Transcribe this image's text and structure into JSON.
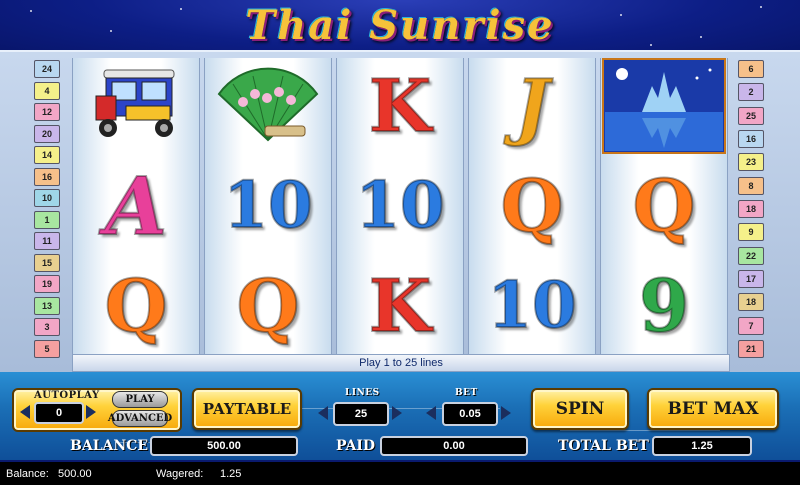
{
  "game": {
    "title": "Thai Sunrise"
  },
  "paylines": {
    "left": [
      "24",
      "4",
      "12",
      "20",
      "14",
      "16",
      "10",
      "1",
      "11",
      "15",
      "19",
      "13",
      "3",
      "5"
    ],
    "right": [
      "6",
      "2",
      "25",
      "16",
      "23",
      "8",
      "18",
      "9",
      "22",
      "17",
      "18",
      "7",
      "21"
    ],
    "left_colors": [
      "#b9d7f0",
      "#f5f08a",
      "#f2a6c6",
      "#c9b6ea",
      "#f5f08a",
      "#f6c08a",
      "#9fd6e8",
      "#a8e6a0",
      "#c9b6ea",
      "#e8d090",
      "#f2a6c6",
      "#a8e6a0",
      "#f2a6c6",
      "#f5a0a0"
    ],
    "right_colors": [
      "#f6c08a",
      "#c9b6ea",
      "#f2a6c6",
      "#b9d7f0",
      "#f5f08a",
      "#f6c08a",
      "#f2a6c6",
      "#f5f08a",
      "#a8e6a0",
      "#c9b6ea",
      "#e8d090",
      "#f2a6c6",
      "#f5a0a0"
    ]
  },
  "reels": [
    [
      {
        "icon": "tuk-tuk-icon"
      },
      {
        "symbol": "A",
        "cls": "sym-A"
      },
      {
        "symbol": "Q",
        "cls": "sym-Q"
      }
    ],
    [
      {
        "icon": "fan-icon"
      },
      {
        "symbol": "10",
        "cls": "sym-10"
      },
      {
        "symbol": "Q",
        "cls": "sym-Q"
      }
    ],
    [
      {
        "symbol": "K",
        "cls": "sym-K"
      },
      {
        "symbol": "10",
        "cls": "sym-10"
      },
      {
        "symbol": "K",
        "cls": "sym-K"
      }
    ],
    [
      {
        "symbol": "J",
        "cls": "sym-J"
      },
      {
        "symbol": "Q",
        "cls": "sym-Q"
      },
      {
        "symbol": "10",
        "cls": "sym-10"
      }
    ],
    [
      {
        "icon": "temple-scene-icon"
      },
      {
        "symbol": "Q",
        "cls": "sym-Q"
      },
      {
        "symbol": "9",
        "cls": "sym-9"
      }
    ]
  ],
  "message": "Play 1 to 25 lines",
  "controls": {
    "autoplay_label": "AUTOPLAY",
    "autoplay_value": "0",
    "play_label": "PLAY",
    "advanced_label": "ADVANCED",
    "paytable_label": "PAYTABLE",
    "lines_label": "LINES",
    "lines_value": "25",
    "bet_label": "BET",
    "bet_value": "0.05",
    "spin_label": "SPIN",
    "betmax_label": "BET MAX"
  },
  "meters": {
    "balance_label": "BALANCE",
    "balance_value": "500.00",
    "paid_label": "PAID",
    "paid_value": "0.00",
    "total_bet_label": "TOTAL BET",
    "total_bet_value": "1.25"
  },
  "status": {
    "balance_label": "Balance:",
    "balance_value": "500.00",
    "wagered_label": "Wagered:",
    "wagered_value": "1.25"
  }
}
